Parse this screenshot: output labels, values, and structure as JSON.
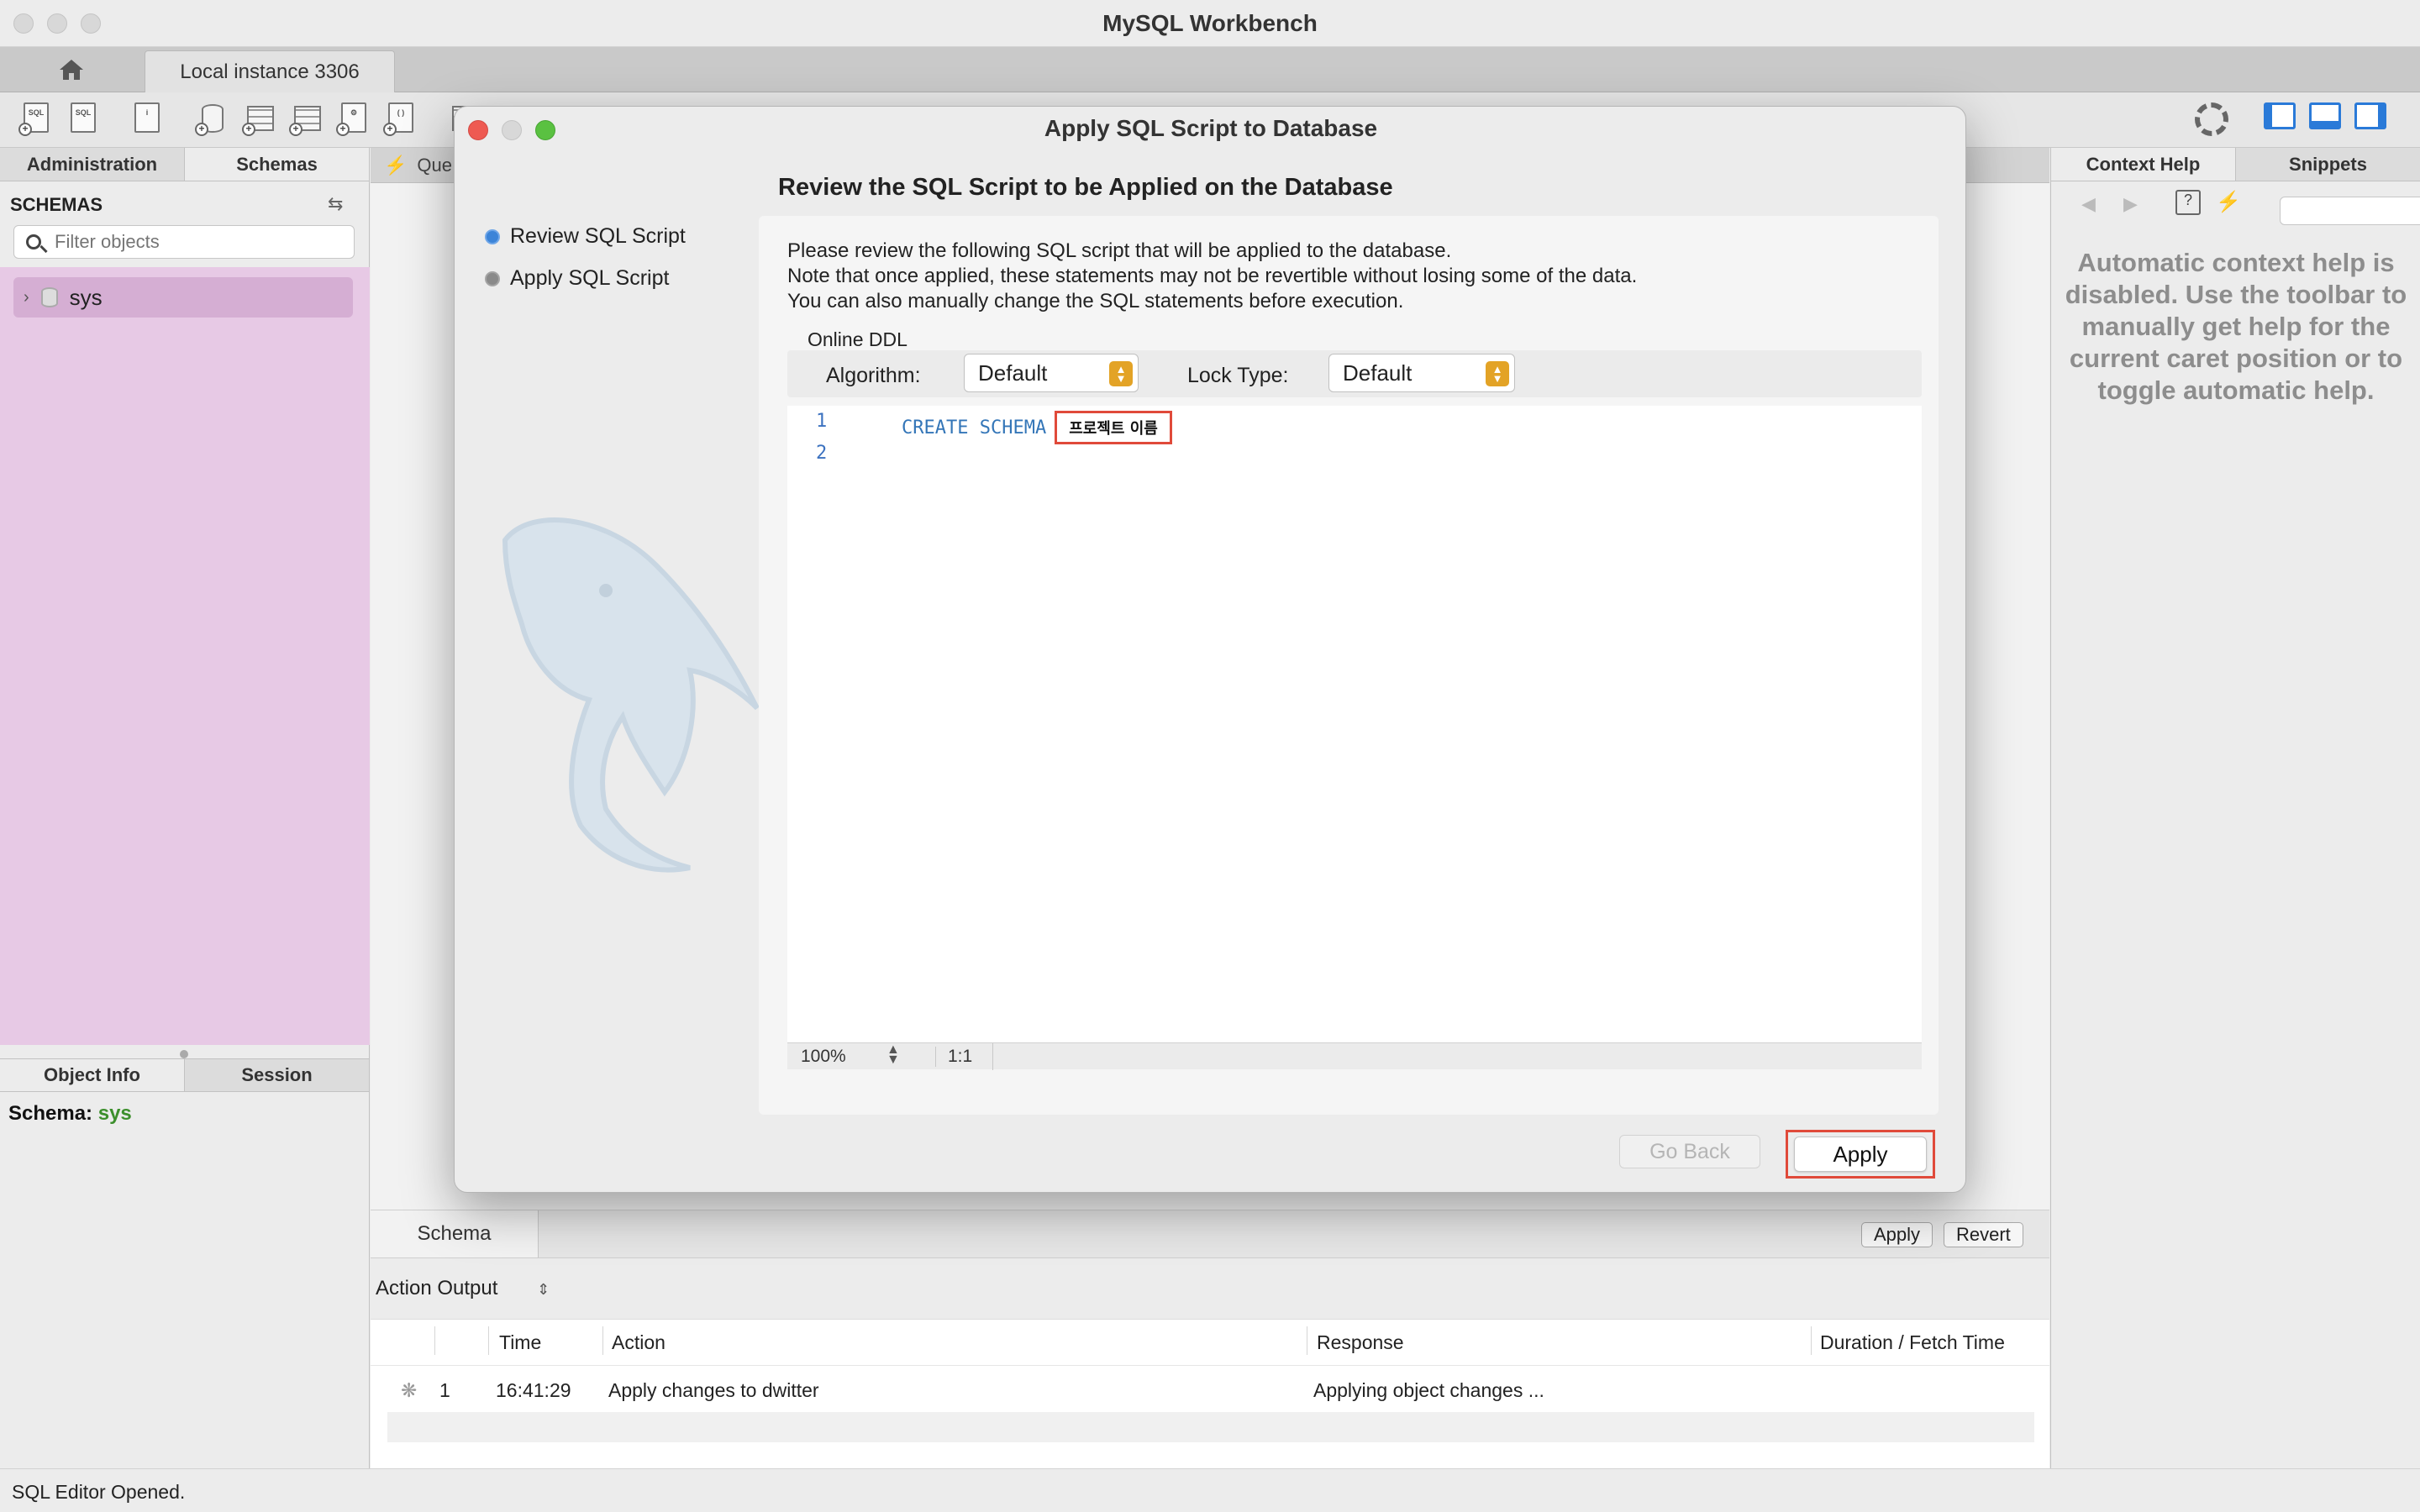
{
  "window": {
    "title": "MySQL Workbench"
  },
  "connection_tabs": {
    "home_icon": "home-icon",
    "active": "Local instance 3306"
  },
  "sidebar": {
    "tabs": [
      "Administration",
      "Schemas"
    ],
    "section_title": "SCHEMAS",
    "filter_placeholder": "Filter objects",
    "tree": [
      {
        "label": "sys"
      }
    ],
    "info_tabs": [
      "Object Info",
      "Session"
    ],
    "schema_info": {
      "label": "Schema:",
      "value": "sys"
    }
  },
  "main": {
    "query_tab_label": "Que",
    "schema_tab": "Schema",
    "apply_label": "Apply",
    "revert_label": "Revert"
  },
  "output": {
    "selector": "Action Output",
    "columns": [
      "Time",
      "Action",
      "Response",
      "Duration / Fetch Time"
    ],
    "rows": [
      {
        "index": "1",
        "time": "16:41:29",
        "action": "Apply changes to dwitter",
        "response": "Applying object changes ...",
        "duration": ""
      }
    ]
  },
  "right_panel": {
    "tabs": [
      "Context Help",
      "Snippets"
    ],
    "help_text": "Automatic context help is disabled. Use the toolbar to manually get help for the current caret position or to toggle automatic help."
  },
  "status_bar": {
    "text": "SQL Editor Opened."
  },
  "dialog": {
    "title": "Apply SQL Script to Database",
    "steps": [
      {
        "label": "Review SQL Script",
        "active": true
      },
      {
        "label": "Apply SQL Script",
        "active": false
      }
    ],
    "heading": "Review the SQL Script to be Applied on the Database",
    "notes": [
      "Please review the following SQL script that will be applied to the database.",
      "Note that once applied, these statements may not be revertible without losing some of the data.",
      "You can also manually change the SQL statements before execution."
    ],
    "online_ddl": {
      "title": "Online DDL",
      "algorithm_label": "Algorithm:",
      "algorithm_value": "Default",
      "lock_label": "Lock Type:",
      "lock_value": "Default"
    },
    "editor": {
      "line_numbers": [
        "1",
        "2"
      ],
      "code_keyword": "CREATE SCHEMA",
      "schema_name": "프로젝트 이름",
      "zoom": "100%",
      "cursor": "1:1"
    },
    "go_back_label": "Go Back",
    "apply_label": "Apply"
  },
  "colors": {
    "accent_red_highlight": "#e04a3a",
    "schema_tree_bg": "#e7c9e5",
    "select_arrow": "#e3a326",
    "schema_value_green": "#3c8f2c"
  }
}
